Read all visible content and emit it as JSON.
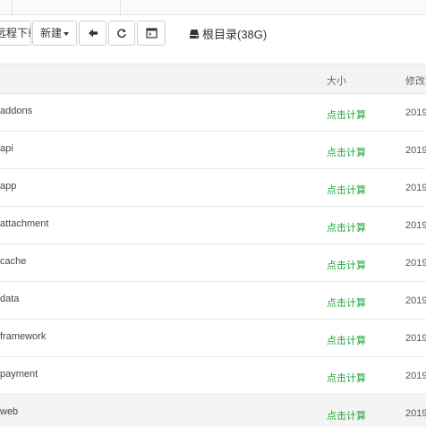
{
  "toolbar": {
    "download_label": "远程下载",
    "new_label": "新建",
    "back_icon": "arrow-left-icon",
    "refresh_icon": "refresh-icon",
    "terminal_icon": "terminal-icon"
  },
  "path": {
    "root_label": "根目录(38G)",
    "disk_icon": "hard-drive-icon"
  },
  "table": {
    "headers": {
      "size": "大小",
      "modified": "修改时间"
    },
    "rows": [
      {
        "name": "addons",
        "size": "点击计算",
        "date": "2019"
      },
      {
        "name": "api",
        "size": "点击计算",
        "date": "2019"
      },
      {
        "name": "app",
        "size": "点击计算",
        "date": "2019"
      },
      {
        "name": "attachment",
        "size": "点击计算",
        "date": "2019"
      },
      {
        "name": "cache",
        "size": "点击计算",
        "date": "2019"
      },
      {
        "name": "data",
        "size": "点击计算",
        "date": "2019"
      },
      {
        "name": "framework",
        "size": "点击计算",
        "date": "2019"
      },
      {
        "name": "payment",
        "size": "点击计算",
        "date": "2019"
      },
      {
        "name": "web",
        "size": "点击计算",
        "date": "2019"
      }
    ]
  },
  "colors": {
    "accent_green": "#20a53a",
    "header_bg": "#f3f3f3",
    "highlight_row_bg": "#f4f4f4"
  }
}
